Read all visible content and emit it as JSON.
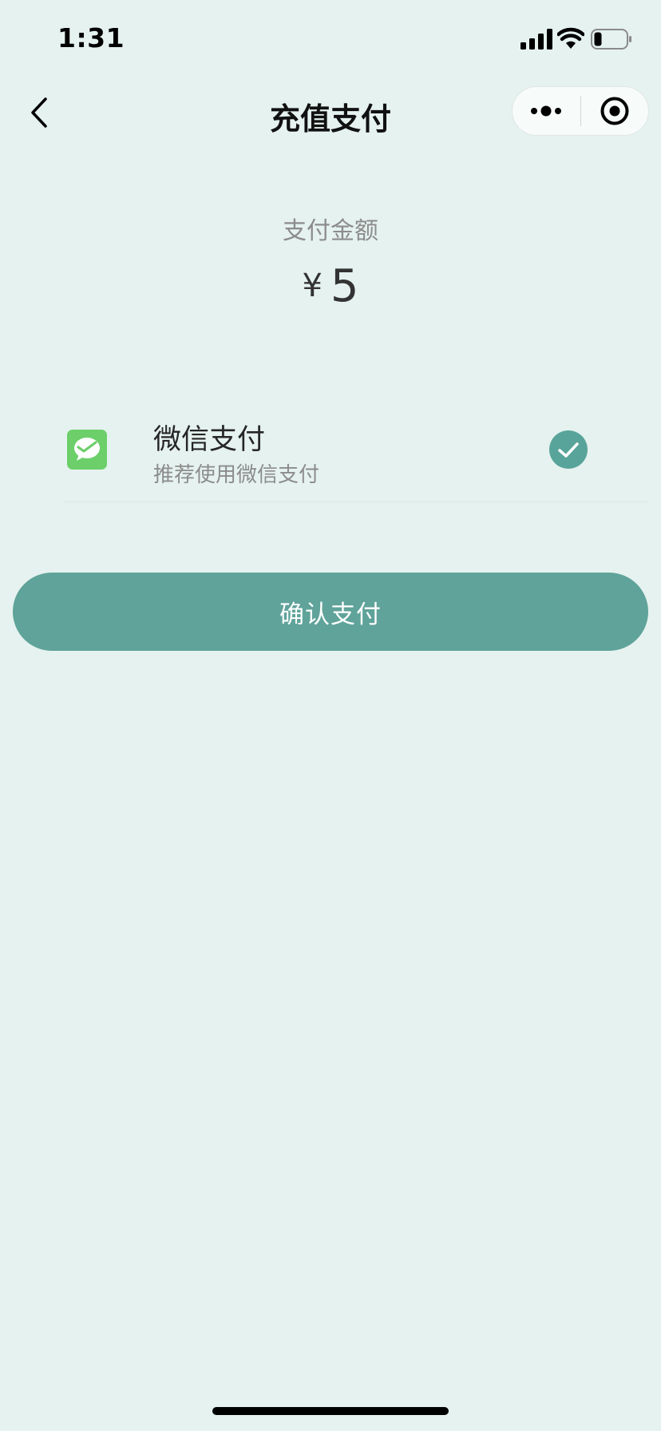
{
  "status_bar": {
    "time": "1:31"
  },
  "nav": {
    "title": "充值支付"
  },
  "payment": {
    "amount_label": "支付金额",
    "currency": "¥",
    "amount": "5"
  },
  "method": {
    "name": "微信支付",
    "description": "推荐使用微信支付",
    "selected": true
  },
  "confirm_label": "确认支付",
  "colors": {
    "background": "#e5f2ef",
    "accent": "#5fa39a",
    "wechat_green": "#6ccf6a"
  },
  "icons": {
    "back": "chevron-left-icon",
    "more": "more-dots-icon",
    "close": "target-circle-icon",
    "wechat": "wechat-pay-icon",
    "check": "check-circle-icon"
  }
}
